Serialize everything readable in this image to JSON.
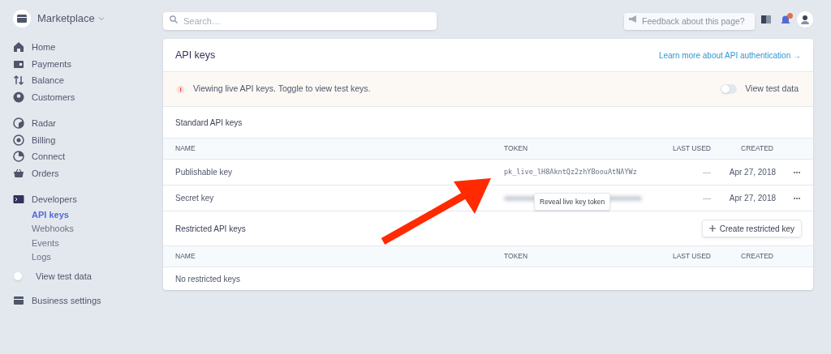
{
  "account": {
    "name": "Marketplace"
  },
  "sidebar": {
    "groups": [
      {
        "items": [
          {
            "label": "Home"
          },
          {
            "label": "Payments"
          },
          {
            "label": "Balance"
          },
          {
            "label": "Customers"
          }
        ]
      },
      {
        "items": [
          {
            "label": "Radar"
          },
          {
            "label": "Billing"
          },
          {
            "label": "Connect"
          },
          {
            "label": "Orders"
          }
        ]
      },
      {
        "items": [
          {
            "label": "Developers",
            "children": [
              {
                "label": "API keys",
                "selected": true
              },
              {
                "label": "Webhooks",
                "selected": false
              },
              {
                "label": "Events",
                "selected": false
              },
              {
                "label": "Logs",
                "selected": false
              }
            ]
          }
        ]
      }
    ],
    "test_toggle": {
      "label": "View test data",
      "on": false
    },
    "footer_item": {
      "label": "Business settings"
    }
  },
  "search": {
    "placeholder": "Search…"
  },
  "feedback": {
    "placeholder": "Feedback about this page?"
  },
  "card": {
    "title": "API keys",
    "link": "Learn more about API authentication →",
    "notice": {
      "text": "Viewing live API keys. Toggle to view test keys.",
      "toggle_label": "View test data",
      "on": false
    },
    "standard": {
      "title": "Standard API keys",
      "columns": [
        "NAME",
        "TOKEN",
        "LAST USED",
        "CREATED"
      ],
      "rows": [
        {
          "name": "Publishable key",
          "token": "pk_live_lH8AkntQz2zhYBoouAtNAYWz",
          "hidden": false,
          "last_used": "—",
          "created": "Apr 27, 2018"
        },
        {
          "name": "Secret key",
          "hidden": true,
          "tooltip": "Reveal live key token",
          "last_used": "—",
          "created": "Apr 27, 2018"
        }
      ]
    },
    "restricted": {
      "title": "Restricted API keys",
      "button": "Create restricted key",
      "columns": [
        "NAME",
        "TOKEN",
        "LAST USED",
        "CREATED"
      ],
      "empty": "No restricted keys"
    }
  }
}
